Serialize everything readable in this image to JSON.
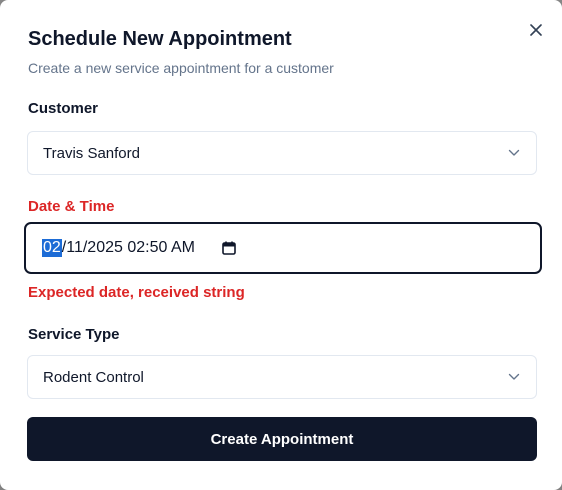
{
  "dialog": {
    "title": "Schedule New Appointment",
    "subtitle": "Create a new service appointment for a customer"
  },
  "customer": {
    "label": "Customer",
    "value": "Travis Sanford"
  },
  "datetime": {
    "label": "Date & Time",
    "month": "02",
    "rest": "/11/2025 02:50 AM",
    "error": "Expected date, received string"
  },
  "service": {
    "label": "Service Type",
    "value": "Rodent Control"
  },
  "submit_label": "Create Appointment",
  "colors": {
    "primary": "#0f172a",
    "error": "#dc2626",
    "muted": "#64748b",
    "selection": "#1d6cd6"
  }
}
